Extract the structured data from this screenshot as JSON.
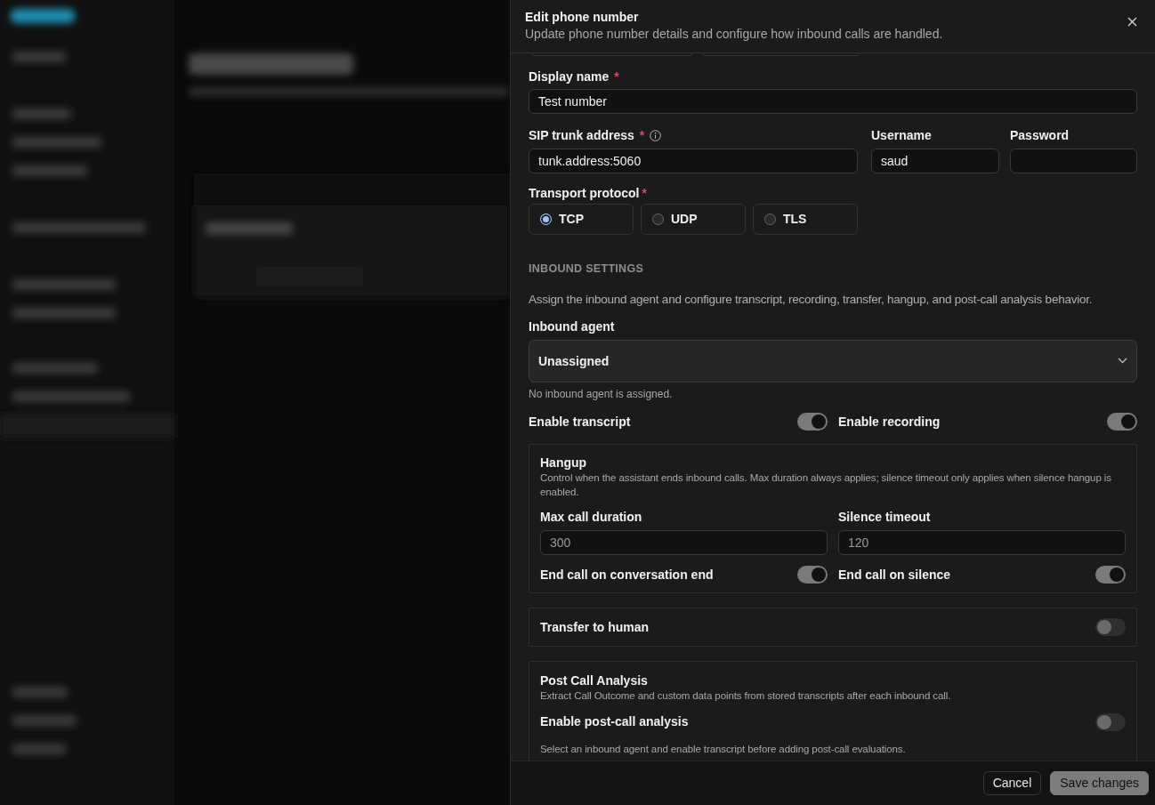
{
  "dialog": {
    "title": "Edit phone number",
    "subtitle": "Update phone number details and configure how inbound calls are handled."
  },
  "display_name": {
    "label": "Display name",
    "mark": "*",
    "value": "Test number"
  },
  "sip_trunk": {
    "label": "SIP trunk address",
    "mark": "*",
    "value": "tunk.address:5060"
  },
  "username": {
    "label": "Username",
    "value": "saud"
  },
  "password": {
    "label": "Password"
  },
  "transport": {
    "label": "Transport protocol",
    "mark": "*",
    "options": [
      {
        "label": "TCP",
        "selected": true
      },
      {
        "label": "UDP",
        "selected": false
      },
      {
        "label": "TLS",
        "selected": false
      }
    ]
  },
  "inbound": {
    "heading": "INBOUND SETTINGS",
    "description": "Assign the inbound agent and configure transcript, recording, transfer, hangup, and post-call analysis behavior.",
    "agent": {
      "label": "Inbound agent",
      "value": "Unassigned",
      "hint": "No inbound agent is assigned."
    },
    "toggles": [
      {
        "label": "Enable transcript",
        "on": true
      },
      {
        "label": "Enable recording",
        "on": true
      }
    ]
  },
  "hangup": {
    "title": "Hangup",
    "description": "Control when the assistant ends inbound calls. Max duration always applies; silence timeout only applies when silence hangup is enabled.",
    "fields": [
      {
        "label": "Max call duration",
        "placeholder": "300"
      },
      {
        "label": "Silence timeout",
        "placeholder": "120"
      }
    ],
    "toggles": [
      {
        "label": "End call on conversation end",
        "on": true
      },
      {
        "label": "End call on silence",
        "on": true
      }
    ]
  },
  "transfer": {
    "label": "Transfer to human",
    "on": false
  },
  "post_call": {
    "title": "Post Call Analysis",
    "description": "Extract Call Outcome and custom data points from stored transcripts after each inbound call.",
    "toggle": {
      "label": "Enable post-call analysis",
      "on": false
    },
    "note": "Select an inbound agent and enable transcript before adding post-call evaluations."
  },
  "footer": {
    "buttons": [
      {
        "label": "Cancel",
        "kind": "secondary"
      },
      {
        "label": "Save changes",
        "kind": "primary"
      }
    ]
  }
}
